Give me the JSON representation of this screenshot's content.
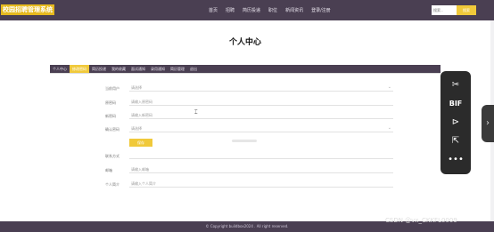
{
  "header": {
    "logo_text": "校园招聘管理系统",
    "nav": [
      "首页",
      "招聘",
      "简历投递",
      "职位",
      "新闻资讯",
      "登录/注册"
    ],
    "search_placeholder": "搜索...",
    "search_button": "搜索"
  },
  "main": {
    "title": "个人中心",
    "tabs": [
      "个人中心",
      "修改密码",
      "简历投递",
      "我的收藏",
      "面试通知",
      "录用通知",
      "简历管理",
      "退出"
    ],
    "active_tab_index": 1,
    "form": {
      "rows": [
        {
          "label": "当前用户",
          "value": "请选择",
          "type": "select"
        },
        {
          "label": "原密码",
          "value": "请输入原密码",
          "type": "input"
        },
        {
          "label": "新密码",
          "value": "请输入新密码",
          "type": "input"
        },
        {
          "label": "确认密码",
          "value": "请选择",
          "type": "select"
        }
      ],
      "save_label": "保存",
      "extra_rows": [
        {
          "label": "联系方式",
          "value": ""
        },
        {
          "label": "邮箱",
          "value": "请输入邮箱"
        },
        {
          "label": "个人简介",
          "value": "请输入个人简介"
        }
      ]
    }
  },
  "toolbox": {
    "icons": [
      "scissors-icon",
      "bif-icon",
      "play-icon",
      "share-icon",
      "more-icon"
    ],
    "bif_text": "BIF"
  },
  "footer": {
    "text": "© Copyright buildbox2024 . All right reserved."
  },
  "watermark": "CSDN @vx_CKKFL0009"
}
